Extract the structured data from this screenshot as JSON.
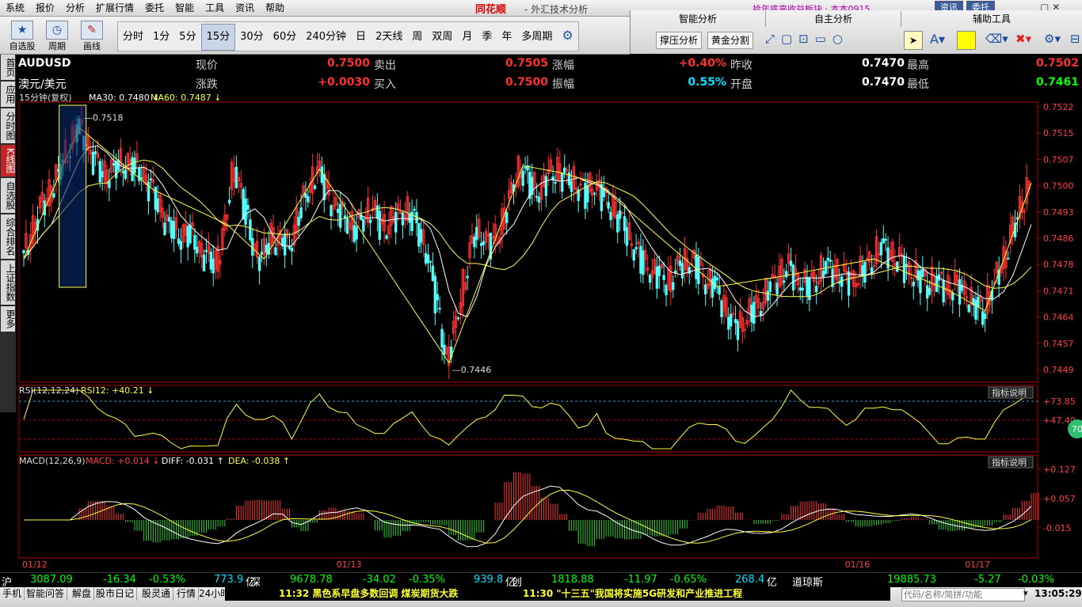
{
  "menu": [
    "系统",
    "报价",
    "分析",
    "扩展行情",
    "委托",
    "智能",
    "工具",
    "资讯",
    "帮助"
  ],
  "brand": "同花顺",
  "brand_subtitle": "- 外汇技术分析",
  "top_ticker": "拾年底高收益板块  ·  本本0915",
  "top_buttons": [
    "资讯",
    "委托"
  ],
  "toolbar_tools": [
    {
      "label": "自选股",
      "icon": "star-icon"
    },
    {
      "label": "周期",
      "icon": "clock-icon"
    },
    {
      "label": "画线",
      "icon": "pen-icon"
    }
  ],
  "periods": [
    "分时",
    "1分",
    "5分",
    "15分",
    "30分",
    "60分",
    "240分钟",
    "日",
    "2天线",
    "周",
    "双周",
    "月",
    "季",
    "年",
    "多周期"
  ],
  "active_period": "15分",
  "panels": {
    "smart": {
      "title": "智能分析",
      "buttons": [
        "撑压分析",
        "黄金分割"
      ]
    },
    "own": {
      "title": "自主分析"
    },
    "aux": {
      "title": "辅助工具",
      "color_swatch": "#ffff00"
    }
  },
  "sidebar_tabs": [
    "首页",
    "应用",
    "分时图",
    "K线图",
    "自选股",
    "综合排名",
    "上证指数",
    "更多"
  ],
  "sidebar_active": "K线图",
  "quote": {
    "symbol": "AUDUSD",
    "name": "澳元/美元",
    "row1": [
      {
        "label": "现价",
        "value": "0.7500",
        "color": "#ff3030"
      },
      {
        "label": "卖出",
        "value": "0.7505",
        "color": "#ff3030"
      },
      {
        "label": "涨幅",
        "value": "+0.40%",
        "color": "#ff3030"
      },
      {
        "label": "昨收",
        "value": "0.7470",
        "color": "#ffffff"
      },
      {
        "label": "最高",
        "value": "0.7502",
        "color": "#ff3030"
      }
    ],
    "row2": [
      {
        "label": "涨跌",
        "value": "+0.0030",
        "color": "#ff3030"
      },
      {
        "label": "买入",
        "value": "0.7500",
        "color": "#ff3030"
      },
      {
        "label": "振幅",
        "value": "0.55%",
        "color": "#00e0ff"
      },
      {
        "label": "开盘",
        "value": "0.7470",
        "color": "#ffffff"
      },
      {
        "label": "最低",
        "value": "0.7461",
        "color": "#00ff00"
      }
    ]
  },
  "ma_legend": {
    "period": "15分钟(复权)",
    "ma30": "MA30: 0.7480",
    "ma60": "MA60: 0.7487"
  },
  "rsi_legend": {
    "name": "RSI(12,12,24)",
    "value": "RSI12: +40.21"
  },
  "macd_legend": {
    "name": "MACD(12,26,9)",
    "macd": "MACD: +0.014",
    "diff": "DIFF: -0.031",
    "dea": "DEA: -0.038"
  },
  "indicator_help": "指标说明",
  "rsi_badge": "70",
  "chart_data": {
    "type": "line",
    "price_axis": [
      "0.7522",
      "0.7515",
      "0.7507",
      "0.7500",
      "0.7493",
      "0.7486",
      "0.7478",
      "0.7471",
      "0.7464",
      "0.7457",
      "0.7449"
    ],
    "price_range": [
      0.7446,
      0.7522
    ],
    "high_label": "0.7518",
    "low_label": "0.7446",
    "rsi_axis": [
      "+73.85",
      "+47.40"
    ],
    "macd_axis": [
      "+0.127",
      "+0.057",
      "-0.015"
    ],
    "date_labels": [
      "01/12",
      "01/13",
      "01/16",
      "01/17"
    ],
    "close": [
      0.7478,
      0.7485,
      0.7492,
      0.7497,
      0.7503,
      0.751,
      0.7516,
      0.7512,
      0.7505,
      0.7502,
      0.7504,
      0.7506,
      0.7505,
      0.7503,
      0.7498,
      0.7492,
      0.7487,
      0.7485,
      0.7486,
      0.7482,
      0.7478,
      0.7476,
      0.7488,
      0.7506,
      0.7494,
      0.7482,
      0.7478,
      0.7484,
      0.7483,
      0.7482,
      0.7492,
      0.7498,
      0.7504,
      0.7497,
      0.7492,
      0.749,
      0.7487,
      0.749,
      0.7493,
      0.7486,
      0.7489,
      0.7491,
      0.7492,
      0.7486,
      0.7478,
      0.7463,
      0.7448,
      0.746,
      0.7474,
      0.7486,
      0.7484,
      0.7482,
      0.7488,
      0.7498,
      0.7505,
      0.75,
      0.7497,
      0.7502,
      0.7503,
      0.7501,
      0.75,
      0.7497,
      0.75,
      0.7495,
      0.7492,
      0.7488,
      0.7483,
      0.7478,
      0.7475,
      0.7473,
      0.7471,
      0.7475,
      0.7478,
      0.7476,
      0.7472,
      0.747,
      0.7464,
      0.7458,
      0.746,
      0.7463,
      0.7466,
      0.747,
      0.7473,
      0.7475,
      0.7472,
      0.747,
      0.7473,
      0.7476,
      0.7474,
      0.7472,
      0.7472,
      0.7475,
      0.7478,
      0.7482,
      0.7479,
      0.7477,
      0.7474,
      0.7473,
      0.7471,
      0.7472,
      0.7469,
      0.747,
      0.7468,
      0.7465,
      0.7463,
      0.747,
      0.7476,
      0.7484,
      0.7492,
      0.75
    ]
  },
  "indices": [
    {
      "name": "沪",
      "price": "3087.09",
      "chg": "-16.34",
      "pct": "-0.53%",
      "amt": "773.9",
      "unit": "亿"
    },
    {
      "name": "深",
      "price": "9678.78",
      "chg": "-34.02",
      "pct": "-0.35%",
      "amt": "939.8",
      "unit": "亿"
    },
    {
      "name": "创",
      "price": "1818.88",
      "chg": "-11.97",
      "pct": "-0.65%",
      "amt": "268.4",
      "unit": "亿"
    },
    {
      "name": "道琼斯",
      "price": "19885.73",
      "chg": "-5.27",
      "pct": "-0.03%"
    }
  ],
  "status_tabs": [
    "手机",
    "智能问答",
    "解盘",
    "股市日记",
    "股灵通",
    "行情",
    "24小时滚动"
  ],
  "news": [
    "11:32 黑色系早盘多数回调 煤炭期货大跌",
    "11:30 \"十三五\"我国将实施5G研发和产业推进工程"
  ],
  "search_placeholder": "代码/名称/简拼/功能",
  "clock": "13:05:29"
}
